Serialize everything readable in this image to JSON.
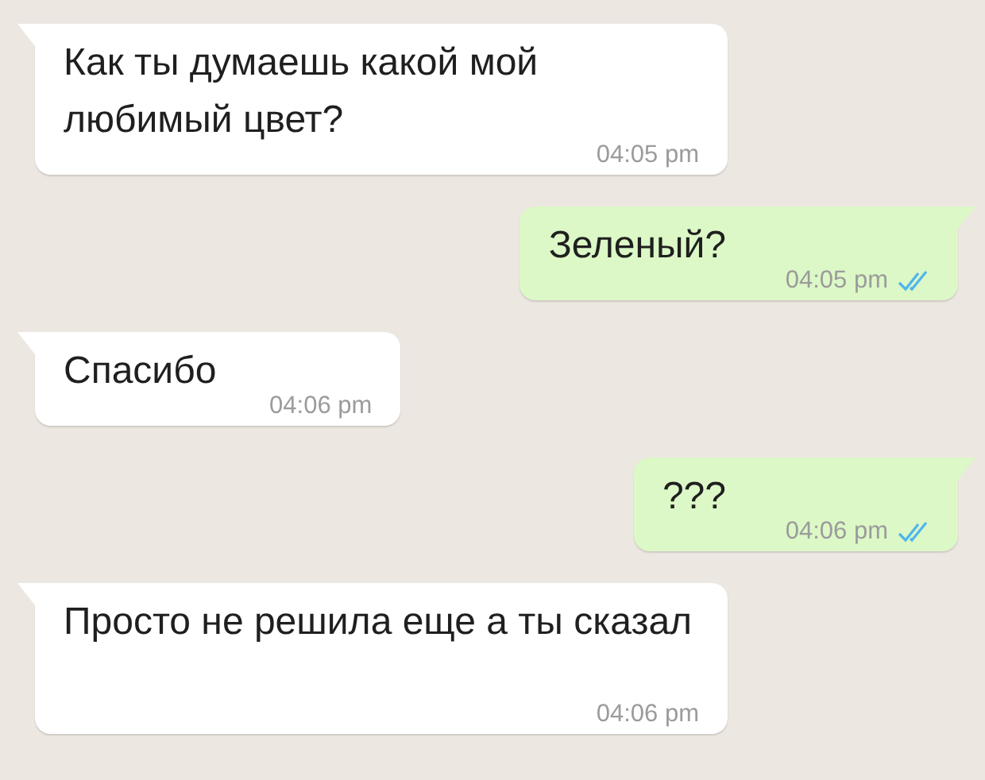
{
  "messages": [
    {
      "kind": "incoming",
      "text": "Как ты думаешь какой мой любимый цвет?",
      "time": "04:05 pm"
    },
    {
      "kind": "outgoing",
      "text": "Зеленый?",
      "time": "04:05 pm",
      "read": true
    },
    {
      "kind": "incoming",
      "text": "Спасибо",
      "time": "04:06 pm"
    },
    {
      "kind": "outgoing",
      "text": "???",
      "time": "04:06 pm",
      "read": true
    },
    {
      "kind": "incoming",
      "text": "Просто не решила еще а ты сказал",
      "time": "04:06 pm"
    }
  ]
}
